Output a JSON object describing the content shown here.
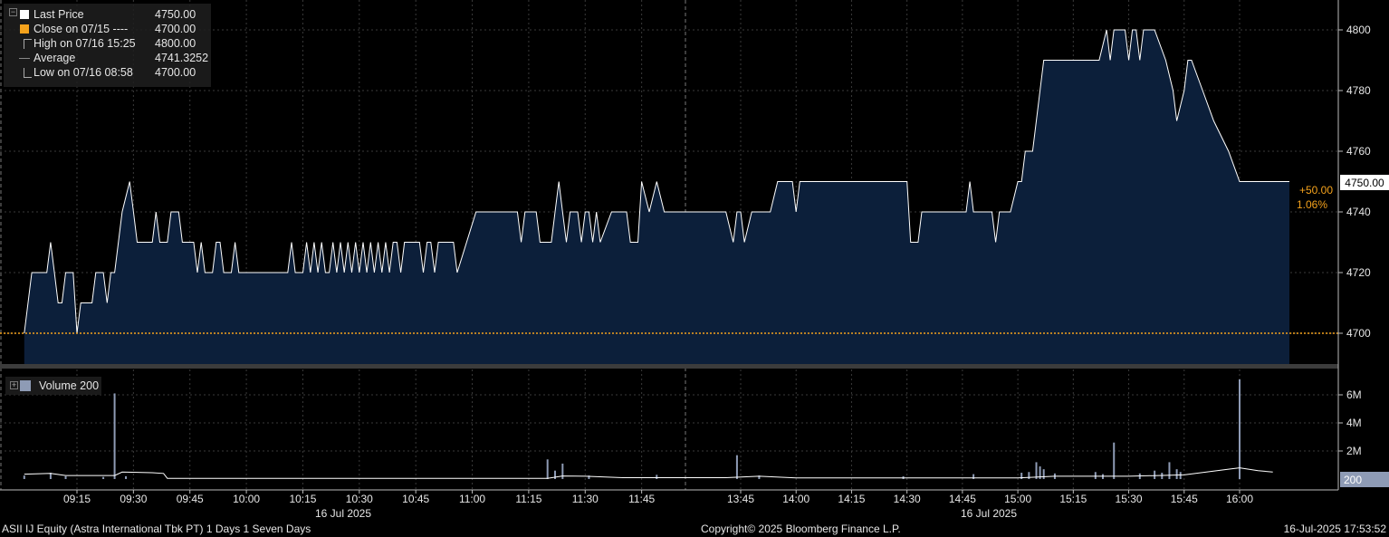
{
  "security": "ASII IJ Equity (Astra International Tbk PT) 1 Days 1 Seven Days",
  "copyright": "Copyright© 2025 Bloomberg Finance L.P.",
  "timestamp": "16-Jul-2025 17:53:52",
  "legend": {
    "last_price": {
      "label": "Last Price",
      "value": "4750.00"
    },
    "close": {
      "label": "Close on 07/15 ----",
      "value": "4700.00"
    },
    "high": {
      "label": "High on 07/16 15:25",
      "value": "4800.00"
    },
    "average": {
      "label": "Average",
      "value": "4741.3252"
    },
    "low": {
      "label": "Low on 07/16 08:58",
      "value": "4700.00"
    },
    "volume": {
      "label": "Volume 200"
    }
  },
  "annotations": {
    "last_price_tag": "4750.00",
    "change": "+50.00",
    "change_pct": "1.06%",
    "volume_tag": "200"
  },
  "colors": {
    "background": "#000000",
    "area_fill": "#0c1f3a",
    "price_line": "#ffffff",
    "close_line": "#f4a21c",
    "volume_bar": "#8e9bb5",
    "grid": "#3a3a3a"
  },
  "chart_data": [
    {
      "type": "area",
      "name": "Last Price",
      "x_axis_date_label": "16 Jul 2025",
      "xticks": [
        "09:15",
        "09:30",
        "09:45",
        "10:00",
        "10:15",
        "10:30",
        "10:45",
        "11:00",
        "11:15",
        "11:30",
        "11:45",
        "13:45",
        "14:00",
        "14:15",
        "14:30",
        "14:45",
        "15:00",
        "15:15",
        "15:30",
        "15:45",
        "16:00"
      ],
      "yticks": [
        "4700",
        "4720",
        "4740",
        "4760",
        "4780",
        "4800"
      ],
      "ylim": [
        4690,
        4810
      ],
      "close_reference": 4700,
      "grid": true,
      "series": [
        {
          "name": "Last Price",
          "points": [
            [
              "09:01",
              4700
            ],
            [
              "09:03",
              4720
            ],
            [
              "09:07",
              4720
            ],
            [
              "09:08",
              4730
            ],
            [
              "09:09",
              4720
            ],
            [
              "09:10",
              4710
            ],
            [
              "09:11",
              4710
            ],
            [
              "09:12",
              4720
            ],
            [
              "09:14",
              4720
            ],
            [
              "09:15",
              4700
            ],
            [
              "09:16",
              4710
            ],
            [
              "09:19",
              4710
            ],
            [
              "09:20",
              4720
            ],
            [
              "09:22",
              4720
            ],
            [
              "09:23",
              4710
            ],
            [
              "09:24",
              4720
            ],
            [
              "09:25",
              4720
            ],
            [
              "09:27",
              4740
            ],
            [
              "09:29",
              4750
            ],
            [
              "09:30",
              4740
            ],
            [
              "09:31",
              4730
            ],
            [
              "09:35",
              4730
            ],
            [
              "09:36",
              4740
            ],
            [
              "09:37",
              4730
            ],
            [
              "09:39",
              4730
            ],
            [
              "09:40",
              4740
            ],
            [
              "09:42",
              4740
            ],
            [
              "09:43",
              4730
            ],
            [
              "09:46",
              4730
            ],
            [
              "09:47",
              4720
            ],
            [
              "09:48",
              4730
            ],
            [
              "09:49",
              4720
            ],
            [
              "09:51",
              4720
            ],
            [
              "09:52",
              4730
            ],
            [
              "09:53",
              4730
            ],
            [
              "09:54",
              4720
            ],
            [
              "09:56",
              4720
            ],
            [
              "09:57",
              4730
            ],
            [
              "09:58",
              4720
            ],
            [
              "10:11",
              4720
            ],
            [
              "10:12",
              4730
            ],
            [
              "10:13",
              4720
            ],
            [
              "10:15",
              4720
            ],
            [
              "10:16",
              4730
            ],
            [
              "10:17",
              4720
            ],
            [
              "10:18",
              4730
            ],
            [
              "10:19",
              4720
            ],
            [
              "10:20",
              4730
            ],
            [
              "10:21",
              4720
            ],
            [
              "10:22",
              4720
            ],
            [
              "10:23",
              4730
            ],
            [
              "10:24",
              4720
            ],
            [
              "10:25",
              4730
            ],
            [
              "10:26",
              4720
            ],
            [
              "10:27",
              4730
            ],
            [
              "10:28",
              4720
            ],
            [
              "10:29",
              4730
            ],
            [
              "10:30",
              4720
            ],
            [
              "10:31",
              4730
            ],
            [
              "10:32",
              4720
            ],
            [
              "10:33",
              4730
            ],
            [
              "10:34",
              4720
            ],
            [
              "10:35",
              4730
            ],
            [
              "10:36",
              4720
            ],
            [
              "10:37",
              4730
            ],
            [
              "10:38",
              4720
            ],
            [
              "10:39",
              4730
            ],
            [
              "10:40",
              4730
            ],
            [
              "10:41",
              4720
            ],
            [
              "10:42",
              4730
            ],
            [
              "10:46",
              4730
            ],
            [
              "10:47",
              4720
            ],
            [
              "10:48",
              4730
            ],
            [
              "10:49",
              4730
            ],
            [
              "10:50",
              4720
            ],
            [
              "10:51",
              4730
            ],
            [
              "10:55",
              4730
            ],
            [
              "10:56",
              4720
            ],
            [
              "11:01",
              4740
            ],
            [
              "11:12",
              4740
            ],
            [
              "11:13",
              4730
            ],
            [
              "11:14",
              4740
            ],
            [
              "11:17",
              4740
            ],
            [
              "11:18",
              4730
            ],
            [
              "11:21",
              4730
            ],
            [
              "11:22",
              4740
            ],
            [
              "11:23",
              4750
            ],
            [
              "11:24",
              4740
            ],
            [
              "11:25",
              4730
            ],
            [
              "11:26",
              4740
            ],
            [
              "11:28",
              4740
            ],
            [
              "11:29",
              4730
            ],
            [
              "11:30",
              4740
            ],
            [
              "11:31",
              4740
            ],
            [
              "11:32",
              4730
            ],
            [
              "11:33",
              4740
            ],
            [
              "11:34",
              4730
            ],
            [
              "11:37",
              4740
            ],
            [
              "11:41",
              4740
            ],
            [
              "11:42",
              4730
            ],
            [
              "11:44",
              4730
            ],
            [
              "11:45",
              4750
            ],
            [
              "11:47",
              4740
            ],
            [
              "11:49",
              4750
            ],
            [
              "11:51",
              4740
            ],
            [
              "13:41",
              4740
            ],
            [
              "13:43",
              4730
            ],
            [
              "13:44",
              4740
            ],
            [
              "13:45",
              4740
            ],
            [
              "13:46",
              4730
            ],
            [
              "13:48",
              4740
            ],
            [
              "13:53",
              4740
            ],
            [
              "13:55",
              4750
            ],
            [
              "13:59",
              4750
            ],
            [
              "14:00",
              4740
            ],
            [
              "14:01",
              4750
            ],
            [
              "14:30",
              4750
            ],
            [
              "14:31",
              4730
            ],
            [
              "14:33",
              4730
            ],
            [
              "14:34",
              4740
            ],
            [
              "14:46",
              4740
            ],
            [
              "14:47",
              4750
            ],
            [
              "14:48",
              4740
            ],
            [
              "14:53",
              4740
            ],
            [
              "14:54",
              4730
            ],
            [
              "14:55",
              4740
            ],
            [
              "14:58",
              4740
            ],
            [
              "15:00",
              4750
            ],
            [
              "15:01",
              4750
            ],
            [
              "15:02",
              4760
            ],
            [
              "15:04",
              4760
            ],
            [
              "15:05",
              4770
            ],
            [
              "15:06",
              4780
            ],
            [
              "15:07",
              4790
            ],
            [
              "15:22",
              4790
            ],
            [
              "15:24",
              4800
            ],
            [
              "15:25",
              4790
            ],
            [
              "15:26",
              4800
            ],
            [
              "15:29",
              4800
            ],
            [
              "15:30",
              4790
            ],
            [
              "15:31",
              4800
            ],
            [
              "15:32",
              4800
            ],
            [
              "15:33",
              4790
            ],
            [
              "15:34",
              4800
            ],
            [
              "15:37",
              4800
            ],
            [
              "15:40",
              4790
            ],
            [
              "15:42",
              4780
            ],
            [
              "15:43",
              4770
            ],
            [
              "15:45",
              4780
            ],
            [
              "15:46",
              4790
            ],
            [
              "15:47",
              4790
            ],
            [
              "15:50",
              4780
            ],
            [
              "15:53",
              4770
            ],
            [
              "15:57",
              4760
            ],
            [
              "16:00",
              4750
            ],
            [
              "16:05",
              4750
            ],
            [
              "16:06",
              4750
            ],
            [
              "16:07",
              4750
            ],
            [
              "16:08",
              4750
            ],
            [
              "16:09",
              4750
            ]
          ]
        }
      ]
    },
    {
      "type": "bar",
      "name": "Volume",
      "yticks": [
        "2M",
        "4M",
        "6M"
      ],
      "ylim": [
        0,
        7200000
      ],
      "grid": true,
      "series": [
        {
          "name": "Volume",
          "points": [
            [
              "09:01",
              250000
            ],
            [
              "09:08",
              450000
            ],
            [
              "09:12",
              200000
            ],
            [
              "09:22",
              150000
            ],
            [
              "09:25",
              6100000
            ],
            [
              "09:28",
              200000
            ],
            [
              "11:20",
              1400000
            ],
            [
              "11:22",
              600000
            ],
            [
              "11:24",
              1100000
            ],
            [
              "11:31",
              250000
            ],
            [
              "11:49",
              300000
            ],
            [
              "13:44",
              1700000
            ],
            [
              "13:50",
              250000
            ],
            [
              "14:29",
              200000
            ],
            [
              "14:48",
              350000
            ],
            [
              "15:01",
              450000
            ],
            [
              "15:03",
              500000
            ],
            [
              "15:05",
              1200000
            ],
            [
              "15:06",
              900000
            ],
            [
              "15:07",
              700000
            ],
            [
              "15:10",
              400000
            ],
            [
              "15:21",
              500000
            ],
            [
              "15:23",
              350000
            ],
            [
              "15:26",
              2600000
            ],
            [
              "15:33",
              400000
            ],
            [
              "15:37",
              600000
            ],
            [
              "15:39",
              450000
            ],
            [
              "15:41",
              1200000
            ],
            [
              "15:43",
              700000
            ],
            [
              "15:44",
              500000
            ],
            [
              "16:00",
              7100000
            ]
          ]
        },
        {
          "name": "Average",
          "points": [
            [
              "09:01",
              350000
            ],
            [
              "09:08",
              400000
            ],
            [
              "09:12",
              250000
            ],
            [
              "09:25",
              250000
            ],
            [
              "09:27",
              500000
            ],
            [
              "09:35",
              450000
            ],
            [
              "09:38",
              400000
            ],
            [
              "09:39",
              50000
            ],
            [
              "11:20",
              50000
            ],
            [
              "11:24",
              220000
            ],
            [
              "11:30",
              200000
            ],
            [
              "11:40",
              100000
            ],
            [
              "13:41",
              100000
            ],
            [
              "13:50",
              200000
            ],
            [
              "14:00",
              80000
            ],
            [
              "15:00",
              80000
            ],
            [
              "15:10",
              200000
            ],
            [
              "15:30",
              200000
            ],
            [
              "15:45",
              300000
            ],
            [
              "15:57",
              700000
            ],
            [
              "16:00",
              800000
            ],
            [
              "16:05",
              600000
            ],
            [
              "16:09",
              500000
            ]
          ]
        }
      ]
    }
  ]
}
